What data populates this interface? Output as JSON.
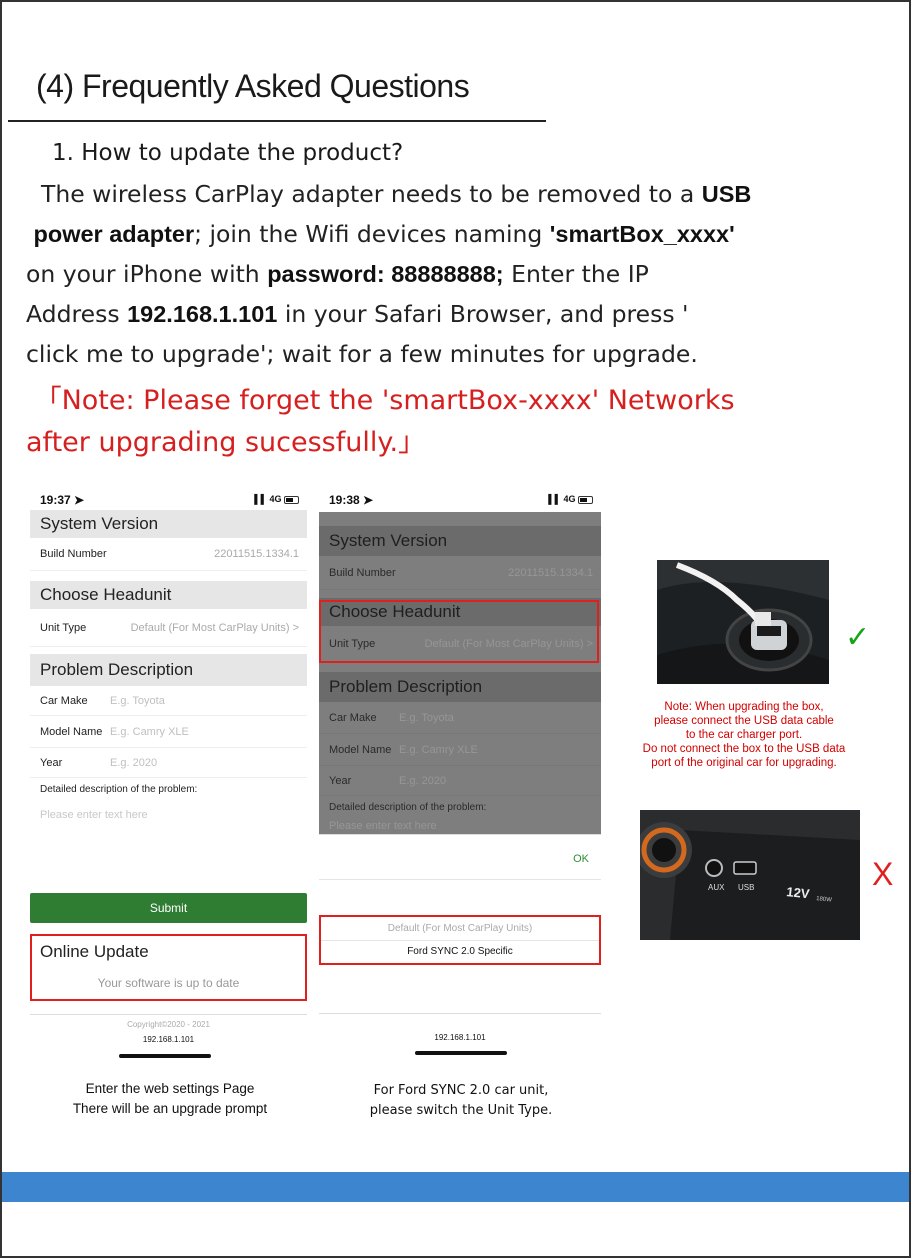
{
  "heading": "(4)  Frequently Asked Questions",
  "question1": "1. How to update the product?",
  "para": {
    "p1": "T",
    "p2": "he wireless ",
    "p3": "CarP",
    "p4": "lay adapter needs to be removed to a ",
    "p5": "USB",
    "p6": "power adapter",
    "p7": "; join the ",
    "p8": "W",
    "p9": "ifi devices naming ",
    "p10": "'smartBox_xxxx'",
    "p11": "on your iPhone with ",
    "p12": "password: 88888888;",
    "p13": " Enter the ",
    "p14": "IP",
    "p15": "A",
    "p16": "ddress ",
    "p17": "192.168.1.101",
    "p18": " in your ",
    "p19": "S",
    "p20": "afari Browser, and press '",
    "p21": "click me to upgrade'; wait for a few minutes for upgrade."
  },
  "note": {
    "open": "「",
    "label": "Note: P",
    "text1": "lease forget the 'smartBox-xxxx' Networks",
    "text2": "after upgrading sucessfully.",
    "close": "」"
  },
  "phone1": {
    "time": "19:37",
    "signal": "4G",
    "sec_system": "System Version",
    "build_label": "Build Number",
    "build_value": "22011515.1334.1",
    "sec_headunit": "Choose Headunit",
    "unit_label": "Unit Type",
    "unit_value": "Default (For Most CarPlay Units) >",
    "sec_problem": "Problem Description",
    "car_make_label": "Car Make",
    "car_make_ph": "E.g. Toyota",
    "model_label": "Model Name",
    "model_ph": "E.g. Camry XLE",
    "year_label": "Year",
    "year_ph": "E.g. 2020",
    "detail_label": "Detailed description of the problem:",
    "detail_ph": "Please enter text here",
    "submit": "Submit",
    "sec_online": "Online Update",
    "online_status": "Your software is up to date",
    "copyright": "Copyright©2020 - 2021",
    "ip": "192.168.1.101"
  },
  "phone2": {
    "time": "19:38",
    "signal": "4G",
    "sec_system": "System Version",
    "build_label": "Build Number",
    "build_value": "22011515.1334.1",
    "sec_headunit": "Choose Headunit",
    "unit_label": "Unit Type",
    "unit_value": "Default (For Most CarPlay Units) >",
    "sec_problem": "Problem Description",
    "car_make_label": "Car Make",
    "car_make_ph": "E.g. Toyota",
    "model_label": "Model Name",
    "model_ph": "E.g. Camry XLE",
    "year_label": "Year",
    "year_ph": "E.g. 2020",
    "detail_label": "Detailed description of the problem:",
    "detail_ph": "Please enter text here",
    "ok": "OK",
    "option1": "Default (For Most CarPlay Units)",
    "option2": "Ford SYNC 2.0 Specific",
    "ip": "192.168.1.101"
  },
  "caption1": {
    "line1": "Enter the web settings Page",
    "line2": "There will be an upgrade prompt"
  },
  "caption2": {
    "line1": "For Ford SYNC 2.0 car unit,",
    "line2": "please switch the Unit Type."
  },
  "photo_note": {
    "l1": "Note:  When upgrading the box,",
    "l2": "please connect the USB data cable",
    "l3": "to the car charger port.",
    "l4": "Do not connect the box to the USB data",
    "l5": "port of the original car for upgrading."
  },
  "photo2_labels": {
    "aux": "AUX",
    "usb": "USB",
    "twelve": "12V",
    "watt": "180W"
  },
  "marks": {
    "check": "✓",
    "cross": "X"
  },
  "colors": {
    "note_red": "#d62020",
    "accent_blue": "#3d86cf",
    "submit_green": "#2f7d33",
    "highlight_red": "#e0201c"
  }
}
